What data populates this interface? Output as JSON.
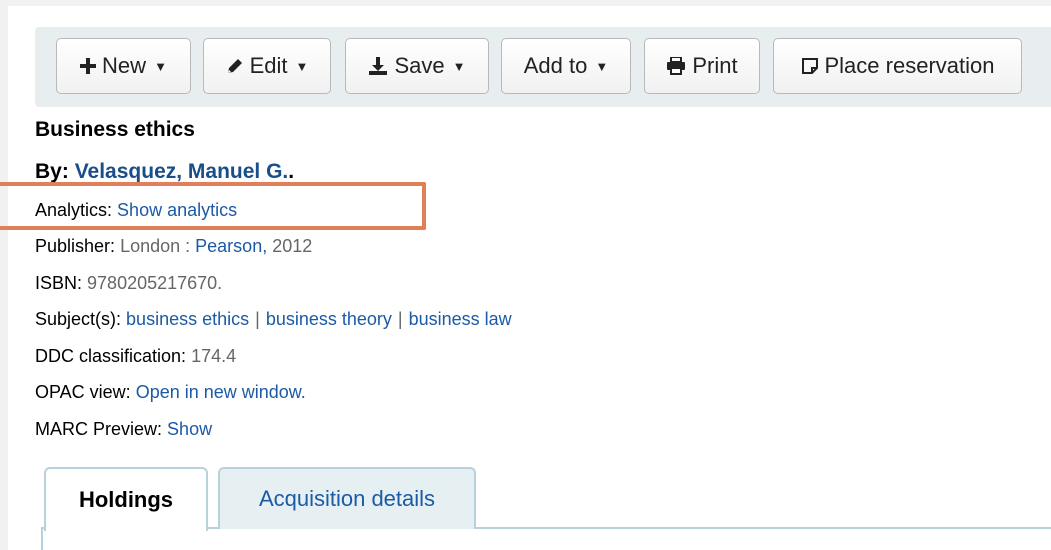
{
  "toolbar": {
    "new_label": "New",
    "edit_label": "Edit",
    "save_label": "Save",
    "addto_label": "Add to",
    "print_label": "Print",
    "reserve_label": "Place reservation"
  },
  "record": {
    "title": "Business ethics",
    "by_label": "By:",
    "author": "Velasquez, Manuel G.",
    "author_suffix": ".",
    "analytics_label": "Analytics:",
    "analytics_link": "Show analytics",
    "publisher_label": "Publisher:",
    "publisher_place": "London :",
    "publisher_name": "Pearson,",
    "publisher_year": "2012",
    "isbn_label": "ISBN:",
    "isbn_value": "9780205217670.",
    "subjects_label": "Subject(s):",
    "subjects": [
      "business ethics",
      "business theory",
      "business law"
    ],
    "subject_separator": "|",
    "ddc_label": "DDC classification:",
    "ddc_value": "174.4",
    "opac_label": "OPAC view:",
    "opac_link": "Open in new window.",
    "marc_label": "MARC Preview:",
    "marc_link": "Show"
  },
  "tabs": [
    {
      "label": "Holdings",
      "active": true
    },
    {
      "label": "Acquisition details",
      "active": false
    }
  ],
  "icons": {
    "new": "plus-icon",
    "edit": "pencil-icon",
    "save": "download-icon",
    "print": "printer-icon",
    "reserve": "sticky-note-icon"
  },
  "colors": {
    "link": "#1c5aa6",
    "toolbar_bg": "#e8eef0",
    "highlight": "#e0805a",
    "tab_border": "#b7d2da"
  }
}
